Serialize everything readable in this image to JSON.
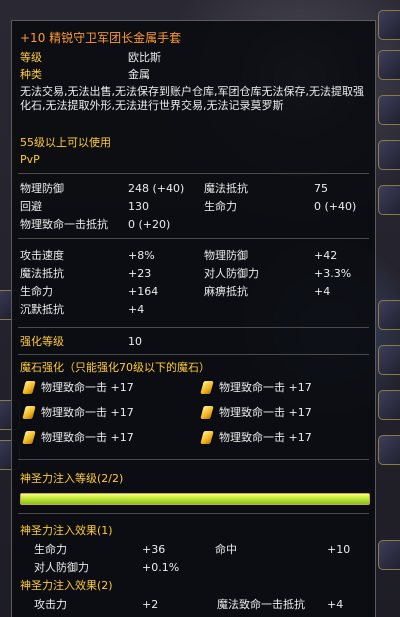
{
  "item": {
    "title": "+10  精锐守卫军团长金属手套",
    "rows": [
      {
        "label": "等级",
        "value": "欧比斯"
      },
      {
        "label": "种类",
        "value": "金属"
      }
    ],
    "restrictions": "无法交易,无法出售,无法保存到账户仓库,军团仓库无法保存,无法提取强化石,无法提取外形,无法进行世界交易,无法记录莫罗斯",
    "level_req": "55级以上可以使用",
    "pvp": "PvP"
  },
  "base_stats": [
    {
      "label": "物理防御",
      "value": "248 (+40)",
      "label2": "魔法抵抗",
      "value2": "75"
    },
    {
      "label": "回避",
      "value": "130",
      "label2": "生命力",
      "value2": "0 (+40)"
    },
    {
      "label": "物理致命一击抵抗",
      "value": "0 (+20)",
      "label2": "",
      "value2": ""
    }
  ],
  "bonus_stats": [
    {
      "label": "攻击速度",
      "value": "+8%",
      "label2": "物理防御",
      "value2": "+42"
    },
    {
      "label": "魔法抵抗",
      "value": "+23",
      "label2": "对人防御力",
      "value2": "+3.3%"
    },
    {
      "label": "生命力",
      "value": "+164",
      "label2": "麻痹抵抗",
      "value2": "+4"
    },
    {
      "label": "沉默抵抗",
      "value": "+4",
      "label2": "",
      "value2": ""
    }
  ],
  "enhance": {
    "label": "强化等级",
    "value": "10"
  },
  "manastone": {
    "header": "魔石强化（只能强化70级以下的魔石）",
    "slots": [
      "物理致命一击 +17",
      "物理致命一击 +17",
      "物理致命一击 +17",
      "物理致命一击 +17",
      "物理致命一击 +17",
      "物理致命一击 +17"
    ]
  },
  "divine": {
    "level_label": "神圣力注入等级(2/2)",
    "progress": 1.0,
    "effect1_header": "神圣力注入效果(1)",
    "effect1": [
      {
        "label": "生命力",
        "value": "+36",
        "label2": "命中",
        "value2": "+10"
      },
      {
        "label": "对人防御力",
        "value": "+0.1%",
        "label2": "",
        "value2": ""
      }
    ],
    "effect2_header": "神圣力注入效果(2)",
    "effect2": [
      {
        "label": "攻击力",
        "value": "+2",
        "label2": "魔法致命一击抵抗",
        "value2": "+4"
      }
    ]
  },
  "colors": {
    "title": "#ff9a2e",
    "header": "#ffcc33",
    "green": "#a6e04a",
    "bar": "#c9e83c"
  }
}
